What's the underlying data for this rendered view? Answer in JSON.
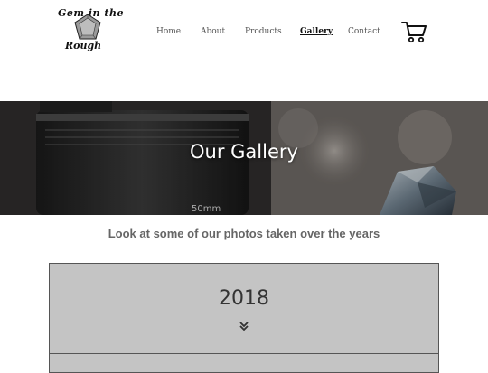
{
  "brand": {
    "line1": "Gem in the",
    "line2": "Rough"
  },
  "nav": {
    "items": [
      {
        "label": "Home"
      },
      {
        "label": "About"
      },
      {
        "label": "Products"
      },
      {
        "label": "Gallery"
      },
      {
        "label": "Contact"
      }
    ],
    "active": "Gallery"
  },
  "icons": {
    "cart": "shopping-cart-icon",
    "chevron": "double-chevron-down-icon",
    "logo": "gem-logo-icon"
  },
  "hero": {
    "title": "Our Gallery",
    "lens_text": "50mm"
  },
  "gallery": {
    "subtitle": "Look at some of our photos taken over the years",
    "years": [
      {
        "year": "2018"
      }
    ]
  },
  "colors": {
    "panel_bg": "#c4c4c4",
    "panel_border": "#555555",
    "subtitle": "#666666"
  }
}
